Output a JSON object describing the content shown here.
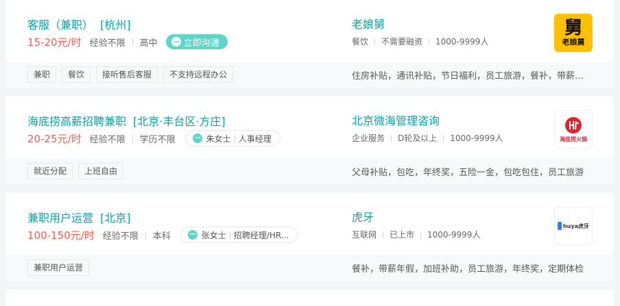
{
  "jobs": [
    {
      "title": "客服（兼职）",
      "area": "[杭州]",
      "salary": "15-20元/时",
      "experience": "经验不限",
      "education": "高中",
      "chat_label": "立即沟通",
      "company": "老娘舅",
      "industry": "餐饮",
      "financing": "不需要融资",
      "size": "1000-9999人",
      "logo_glyph": "舅",
      "logo_text": "老娘舅",
      "tags": [
        "兼职",
        "餐饮",
        "接听售后客服",
        "不支持远程办公"
      ],
      "welfare": "住房补贴，通讯补贴，节日福利，员工旅游，餐补，带薪年假"
    },
    {
      "title": "海底捞高薪招聘兼职",
      "area": "[北京·丰台区·方庄]",
      "salary": "20-25元/时",
      "experience": "经验不限",
      "education": "学历不限",
      "recruiter_name": "朱女士",
      "recruiter_title": "人事经理",
      "company": "北京微海管理咨询",
      "industry": "企业服务",
      "financing": "D轮及以上",
      "size": "1000-9999人",
      "logo_text": "海底捞火锅",
      "tags": [
        "就近分配",
        "上班自由"
      ],
      "welfare": "父母补贴，包吃，年终奖，五险一金，包吃包住，员工旅游"
    },
    {
      "title": "兼职用户运营",
      "area": "[北京]",
      "salary": "100-150元/时",
      "experience": "经验不限",
      "education": "本科",
      "recruiter_name": "张女士",
      "recruiter_title": "招聘经理/HR...",
      "company": "虎牙",
      "industry": "互联网",
      "financing": "已上市",
      "size": "1000-9999人",
      "logo_text": "huya虎牙",
      "tags": [
        "兼职用户运营"
      ],
      "welfare": "餐补，带薪年假，加班补助，员工旅游，年终奖，定期体检"
    }
  ],
  "colors": {
    "accent": "#00a6a7",
    "salary": "#fe574a",
    "chat_button": "#5dd5c8",
    "brand_yellow": "#ffc000",
    "brand_red": "#e5222c"
  }
}
